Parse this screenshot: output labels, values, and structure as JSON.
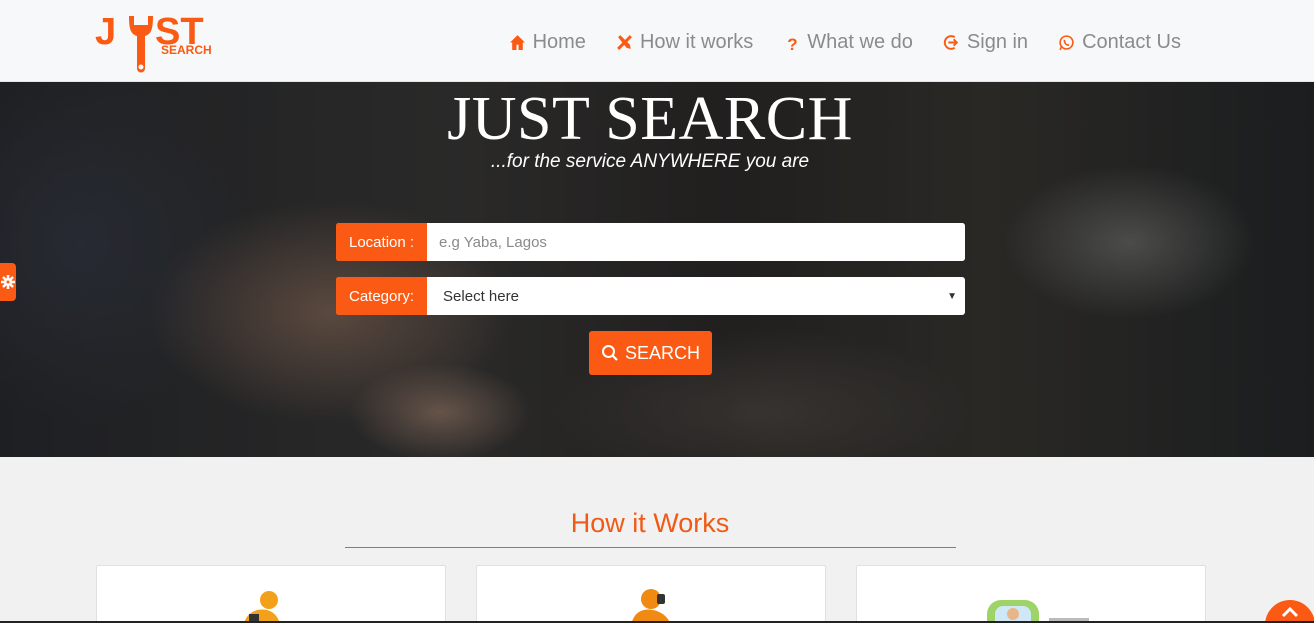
{
  "brand": {
    "logo_text_main": "JUST",
    "logo_text_sub": "SEARCH",
    "accent_color": "#fb5a14"
  },
  "nav": {
    "items": [
      {
        "label": "Home",
        "icon": "home-icon"
      },
      {
        "label": "How it works",
        "icon": "tools-icon"
      },
      {
        "label": "What we do",
        "icon": "question-icon"
      },
      {
        "label": "Sign in",
        "icon": "sign-in-icon"
      },
      {
        "label": "Contact Us",
        "icon": "whatsapp-icon"
      }
    ]
  },
  "hero": {
    "title": "JUST SEARCH",
    "subtitle": "...for the service ANYWHERE you are",
    "location_label": "Location :",
    "location_placeholder": "e.g Yaba, Lagos",
    "category_label": "Category:",
    "category_value": "Select here",
    "search_label": "SEARCH"
  },
  "how_it_works": {
    "title": "How it Works",
    "cards": [
      {
        "icon": "person-searching-icon"
      },
      {
        "icon": "person-phone-icon"
      },
      {
        "icon": "mechanic-window-icon"
      }
    ]
  }
}
